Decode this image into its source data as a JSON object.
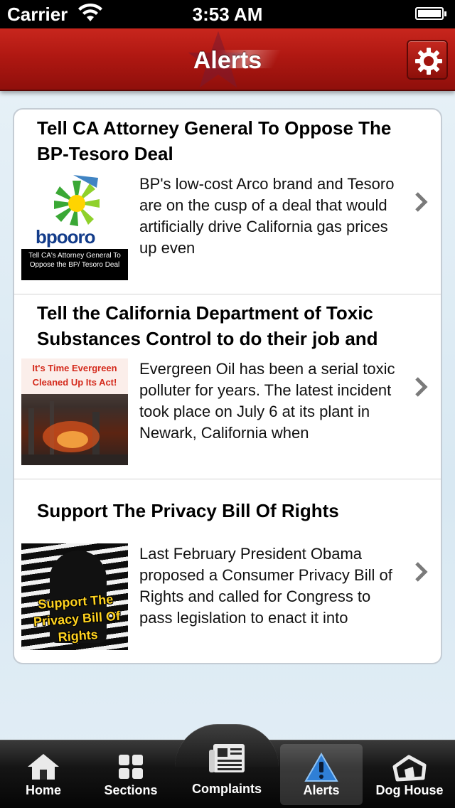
{
  "status_bar": {
    "carrier": "Carrier",
    "time": "3:53 AM"
  },
  "nav": {
    "title": "Alerts",
    "settings_icon": "gear-icon"
  },
  "alerts": [
    {
      "title": "Tell CA Attorney General To Oppose The BP-Tesoro Deal",
      "body": "BP's low-cost Arco brand and Tesoro are on the cusp of a deal that would artificially drive California gas prices up even",
      "thumb_brand": "bpooro",
      "thumb_caption": "Tell CA's Attorney General To Oppose the BP/ Tesoro Deal"
    },
    {
      "title": "Tell the California Department of Toxic Substances Control to do their job and",
      "body": "Evergreen Oil has been a serial toxic polluter for years. The latest incident took place on July 6 at its plant in Newark, California when",
      "thumb_caption": "It's Time Evergreen Cleaned Up Its Act!"
    },
    {
      "title": "Support The Privacy Bill Of Rights",
      "body": "Last February President Obama proposed a Consumer Privacy Bill of Rights and called for Congress to pass legislation to enact it into",
      "thumb_caption": "Support The Privacy Bill Of Rights"
    }
  ],
  "tabs": [
    {
      "label": "Home",
      "icon": "home-icon"
    },
    {
      "label": "Sections",
      "icon": "grid-icon"
    },
    {
      "label": "Complaints",
      "icon": "newspaper-icon"
    },
    {
      "label": "Alerts",
      "icon": "warning-icon",
      "active": true
    },
    {
      "label": "Dog House",
      "icon": "dog-house-icon"
    }
  ],
  "colors": {
    "nav_red": "#b01812",
    "tab_bar": "#151515",
    "alert_icon_blue": "#2f7fd6"
  }
}
